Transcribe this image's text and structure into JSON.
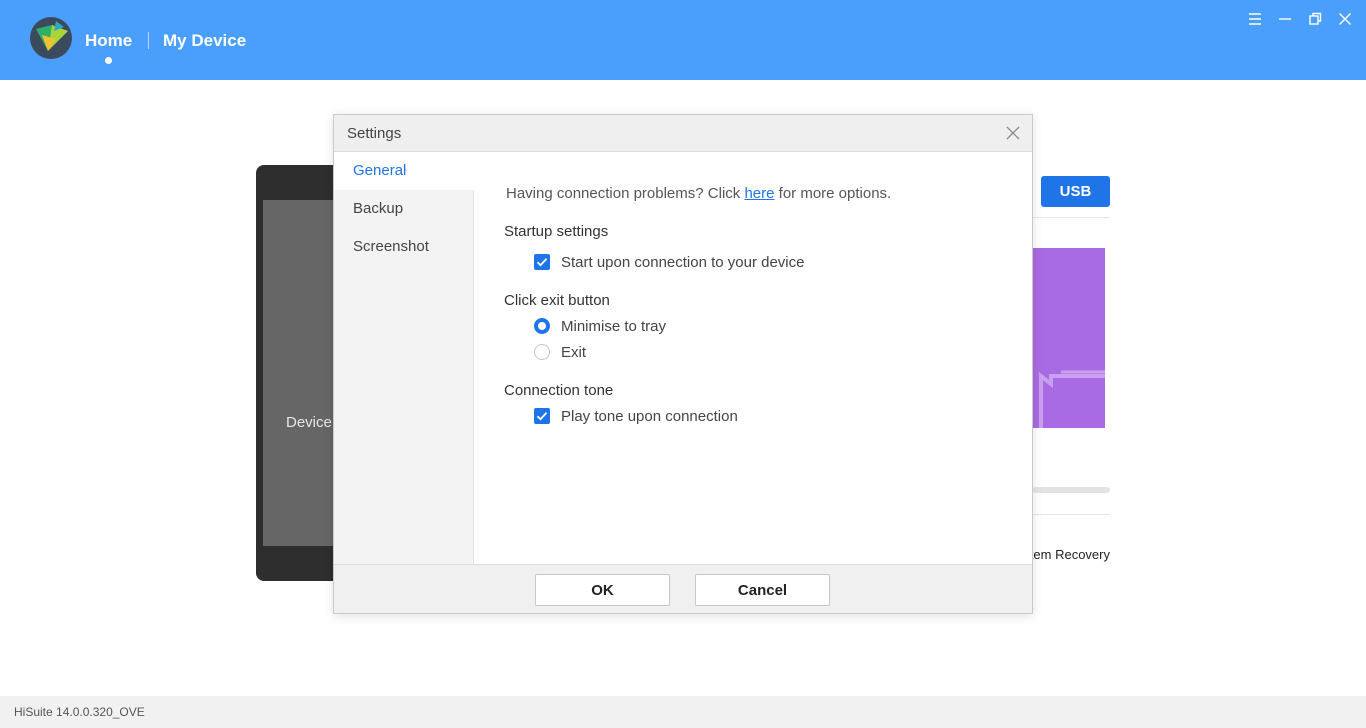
{
  "header": {
    "nav": {
      "home": "Home",
      "my_device": "My Device"
    },
    "accent": "#4a9ffc"
  },
  "background": {
    "device_label": "Device",
    "usb_button": "USB",
    "system_recovery": "System Recovery"
  },
  "dialog": {
    "title": "Settings",
    "sidebar": [
      {
        "label": "General",
        "active": true
      },
      {
        "label": "Backup",
        "active": false
      },
      {
        "label": "Screenshot",
        "active": false
      }
    ],
    "info": {
      "prefix": "Having connection problems? Click ",
      "link": "here",
      "suffix": " for more options."
    },
    "startup": {
      "title": "Startup settings",
      "option": "Start upon connection to your device",
      "checked": true
    },
    "exit": {
      "title": "Click exit button",
      "option_minimise": "Minimise to tray",
      "option_exit": "Exit",
      "selected": "Minimise to tray"
    },
    "tone": {
      "title": "Connection tone",
      "option": "Play tone upon connection",
      "checked": true
    },
    "buttons": {
      "ok": "OK",
      "cancel": "Cancel"
    },
    "accent": "#1f75e8"
  },
  "footer": {
    "version": "HiSuite 14.0.0.320_OVE"
  }
}
